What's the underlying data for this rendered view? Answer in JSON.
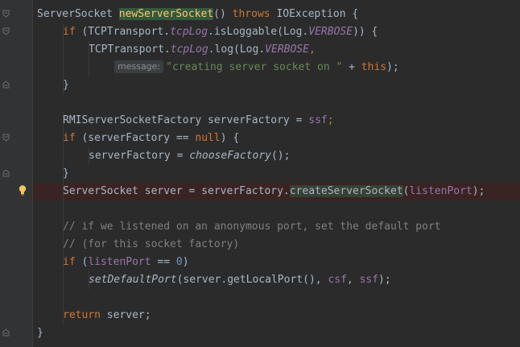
{
  "editor": {
    "lines": [
      {
        "tokens": [
          {
            "t": "ServerSocket ",
            "c": ""
          },
          {
            "t": "newServerSocket",
            "c": "fn fn-match"
          },
          {
            "t": "() ",
            "c": ""
          },
          {
            "t": "throws ",
            "c": "kw"
          },
          {
            "t": "IOException {",
            "c": ""
          }
        ]
      },
      {
        "tokens": [
          {
            "t": "if ",
            "c": "kw"
          },
          {
            "t": "(TCPTransport.",
            "c": ""
          },
          {
            "t": "tcpLog",
            "c": "sfld"
          },
          {
            "t": ".isLoggable(Log.",
            "c": ""
          },
          {
            "t": "VERBOSE",
            "c": "sfld"
          },
          {
            "t": ")) {",
            "c": ""
          }
        ]
      },
      {
        "tokens": [
          {
            "t": "TCPTransport.",
            "c": ""
          },
          {
            "t": "tcpLog",
            "c": "sfld"
          },
          {
            "t": ".log(Log.",
            "c": ""
          },
          {
            "t": "VERBOSE",
            "c": "sfld"
          },
          {
            "t": ",",
            "c": "kw"
          }
        ]
      },
      {
        "hint": "message:",
        "tokens": [
          {
            "t": "\"creating server socket on \" ",
            "c": "str"
          },
          {
            "t": "+ ",
            "c": ""
          },
          {
            "t": "this",
            "c": "kw"
          },
          {
            "t": ");",
            "c": ""
          }
        ]
      },
      {
        "tokens": [
          {
            "t": "}",
            "c": ""
          }
        ]
      },
      {
        "tokens": []
      },
      {
        "tokens": [
          {
            "t": "RMIServerSocketFactory serverFactory = ",
            "c": ""
          },
          {
            "t": "ssf",
            "c": "ivar"
          },
          {
            "t": ";",
            "c": "kw"
          }
        ]
      },
      {
        "tokens": [
          {
            "t": "if ",
            "c": "kw"
          },
          {
            "t": "(serverFactory == ",
            "c": ""
          },
          {
            "t": "null",
            "c": "kw"
          },
          {
            "t": ") {",
            "c": ""
          }
        ]
      },
      {
        "tokens": [
          {
            "t": "serverFactory = ",
            "c": ""
          },
          {
            "t": "chooseFactory",
            "c": "smeth"
          },
          {
            "t": "();",
            "c": ""
          }
        ]
      },
      {
        "tokens": [
          {
            "t": "}",
            "c": ""
          }
        ]
      },
      {
        "tokens": [
          {
            "t": "ServerSocket server = serverFactory.",
            "c": ""
          },
          {
            "t": "createServerSocket",
            "c": "warnmeth"
          },
          {
            "t": "(",
            "c": ""
          },
          {
            "t": "listenPort",
            "c": "ivar"
          },
          {
            "t": ");",
            "c": ""
          }
        ]
      },
      {
        "tokens": []
      },
      {
        "tokens": [
          {
            "t": "// if we listened on an anonymous port, set the default port",
            "c": "cmt"
          }
        ]
      },
      {
        "tokens": [
          {
            "t": "// (for this socket factory)",
            "c": "cmt"
          }
        ]
      },
      {
        "tokens": [
          {
            "t": "if ",
            "c": "kw"
          },
          {
            "t": "(",
            "c": ""
          },
          {
            "t": "listenPort ",
            "c": "ivar"
          },
          {
            "t": "== ",
            "c": ""
          },
          {
            "t": "0",
            "c": "num"
          },
          {
            "t": ")",
            "c": ""
          }
        ]
      },
      {
        "tokens": [
          {
            "t": "setDefaultPort",
            "c": "smeth"
          },
          {
            "t": "(server.getLocalPort(), ",
            "c": ""
          },
          {
            "t": "csf",
            "c": "ivar"
          },
          {
            "t": ", ",
            "c": ""
          },
          {
            "t": "ssf",
            "c": "ivar"
          },
          {
            "t": ");",
            "c": ""
          }
        ]
      },
      {
        "tokens": []
      },
      {
        "tokens": [
          {
            "t": "return ",
            "c": "kw"
          },
          {
            "t": "server;",
            "c": ""
          }
        ]
      },
      {
        "tokens": [
          {
            "t": "}",
            "c": ""
          }
        ]
      }
    ]
  },
  "gutter": {
    "icons": [
      "fold-open-icon",
      "fold-close-icon",
      "lightbulb-icon"
    ]
  },
  "colors": {
    "background": "#2b2b2b",
    "keyword": "#cc7832",
    "method_decl": "#ffc66d",
    "field": "#9876aa",
    "string": "#6a8759",
    "number": "#6897bb",
    "comment": "#808080",
    "error_line": "#3a2323"
  }
}
